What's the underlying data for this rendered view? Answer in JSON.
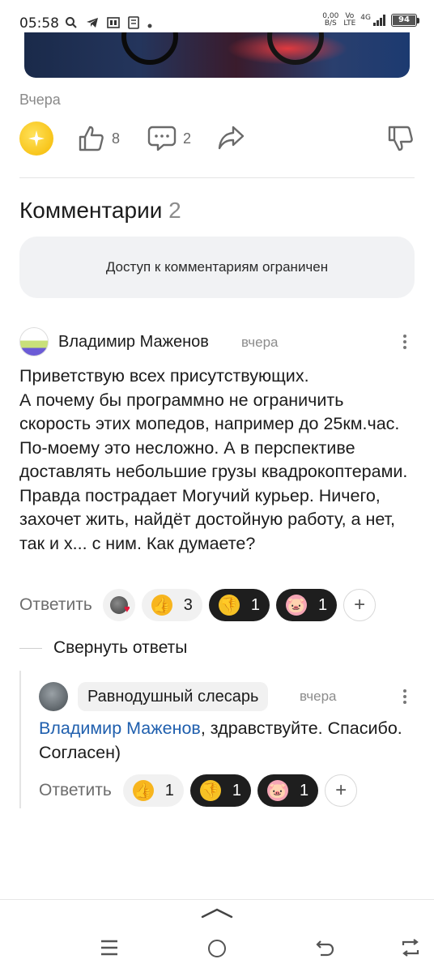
{
  "status_bar": {
    "time": "05:58",
    "net_speed_top": "0,00",
    "net_speed_bottom": "B/S",
    "volte_top": "Vo",
    "volte_bottom": "LTE",
    "network": "4G",
    "battery": "94"
  },
  "post": {
    "date": "Вчера",
    "likes": "8",
    "comments_count": "2"
  },
  "comments_section": {
    "title": "Комментарии",
    "count": "2",
    "restricted_notice": "Доступ к комментариям ограничен"
  },
  "comment1": {
    "author": "Владимир Маженов",
    "time": "вчера",
    "text": "Приветствую всех присутствующих.\nА почему бы программно не ограничить скорость этих мопедов, например до 25км.час. По-моему это несложно. А в перспективе доставлять небольшие грузы квадрокоптерами. Правда пострадает Могучий курьер. Ничего, захочет жить, найдёт достойную работу, а нет, так и х... с ним. Как думаете?",
    "reply_label": "Ответить",
    "reactions": [
      {
        "emoji": "👍",
        "count": "3"
      },
      {
        "emoji": "👎",
        "count": "1"
      },
      {
        "emoji": "🐷",
        "count": "1"
      }
    ],
    "add_label": "+"
  },
  "collapse_label": "Свернуть ответы",
  "comment2": {
    "author": "Равнодушный слесарь",
    "time": "вчера",
    "mention": "Владимир Маженов",
    "text": ", здравствуйте. Спасибо. Согласен)",
    "reply_label": "Ответить",
    "reactions": [
      {
        "emoji": "👍",
        "count": "1"
      },
      {
        "emoji": "👎",
        "count": "1"
      },
      {
        "emoji": "🐷",
        "count": "1"
      }
    ],
    "add_label": "+"
  },
  "icons": [
    "search-icon",
    "telegram-icon",
    "sim-icon",
    "bookmark-icon",
    "signal-icon",
    "battery-icon",
    "star-icon",
    "like-icon",
    "comment-icon",
    "share-icon",
    "dislike-icon",
    "more-icon",
    "menu-icon",
    "home-icon",
    "back-icon",
    "switch-icon"
  ]
}
